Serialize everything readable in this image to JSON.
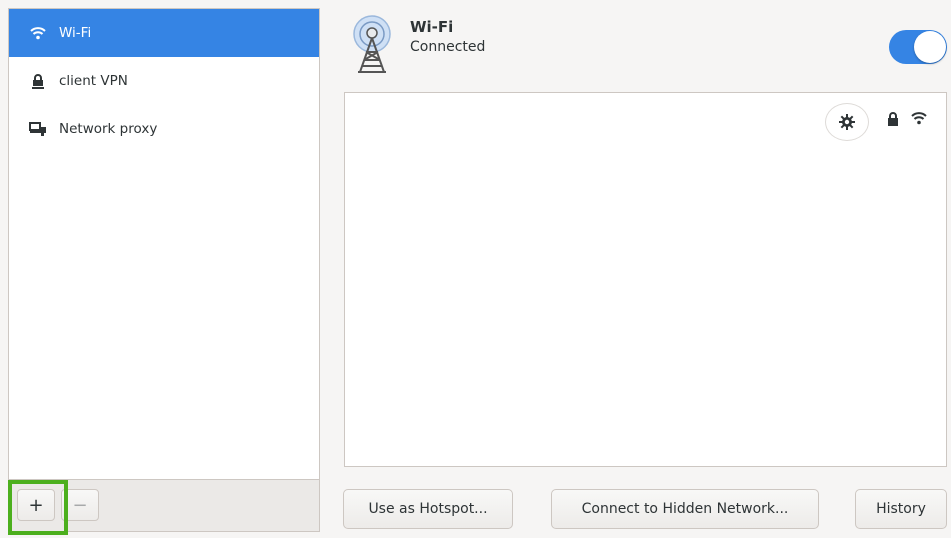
{
  "sidebar": {
    "items": [
      {
        "label": "Wi-Fi",
        "icon": "wifi-icon",
        "selected": true
      },
      {
        "label": "client VPN",
        "icon": "vpn-lock-icon",
        "selected": false
      },
      {
        "label": "Network proxy",
        "icon": "network-proxy-icon",
        "selected": false
      }
    ],
    "add_label": "+",
    "remove_label": "−"
  },
  "header": {
    "title": "Wi-Fi",
    "status": "Connected",
    "icon": "wifi-tower-icon",
    "toggle_on": true
  },
  "network_row": {
    "icons": [
      "gear-icon",
      "lock-icon",
      "signal-icon"
    ]
  },
  "buttons": {
    "hotspot_label": "Use as Hotspot...",
    "hidden_network_label": "Connect to Hidden Network...",
    "history_label": "History"
  },
  "colors": {
    "accent": "#3584e4",
    "highlight": "#4caf1d"
  }
}
